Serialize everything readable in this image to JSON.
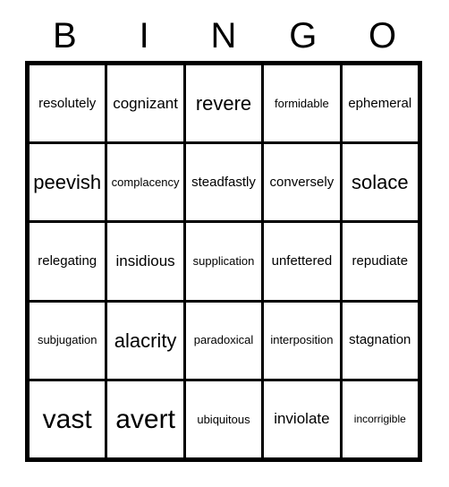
{
  "card": {
    "header_letters": [
      "B",
      "I",
      "N",
      "G",
      "O"
    ],
    "colors": {
      "grid_line": "#000000",
      "cell_background": "#ffffff",
      "text": "#000000",
      "page_background": "#ffffff"
    },
    "rows": [
      [
        {
          "word": "resolutely",
          "size": "fs-md"
        },
        {
          "word": "cognizant",
          "size": "fs-lg"
        },
        {
          "word": "revere",
          "size": "fs-xl"
        },
        {
          "word": "formidable",
          "size": "fs-sm"
        },
        {
          "word": "ephemeral",
          "size": "fs-md"
        }
      ],
      [
        {
          "word": "peevish",
          "size": "fs-xl"
        },
        {
          "word": "complacency",
          "size": "fs-sm"
        },
        {
          "word": "steadfastly",
          "size": "fs-md"
        },
        {
          "word": "conversely",
          "size": "fs-md"
        },
        {
          "word": "solace",
          "size": "fs-xl"
        }
      ],
      [
        {
          "word": "relegating",
          "size": "fs-md"
        },
        {
          "word": "insidious",
          "size": "fs-lg"
        },
        {
          "word": "supplication",
          "size": "fs-sm"
        },
        {
          "word": "unfettered",
          "size": "fs-md"
        },
        {
          "word": "repudiate",
          "size": "fs-md"
        }
      ],
      [
        {
          "word": "subjugation",
          "size": "fs-sm"
        },
        {
          "word": "alacrity",
          "size": "fs-xl"
        },
        {
          "word": "paradoxical",
          "size": "fs-sm"
        },
        {
          "word": "interposition",
          "size": "fs-sm"
        },
        {
          "word": "stagnation",
          "size": "fs-md"
        }
      ],
      [
        {
          "word": "vast",
          "size": "fs-xxl"
        },
        {
          "word": "avert",
          "size": "fs-xxl"
        },
        {
          "word": "ubiquitous",
          "size": "fs-sm"
        },
        {
          "word": "inviolate",
          "size": "fs-lg"
        },
        {
          "word": "incorrigible",
          "size": "fs-xs"
        }
      ]
    ]
  }
}
